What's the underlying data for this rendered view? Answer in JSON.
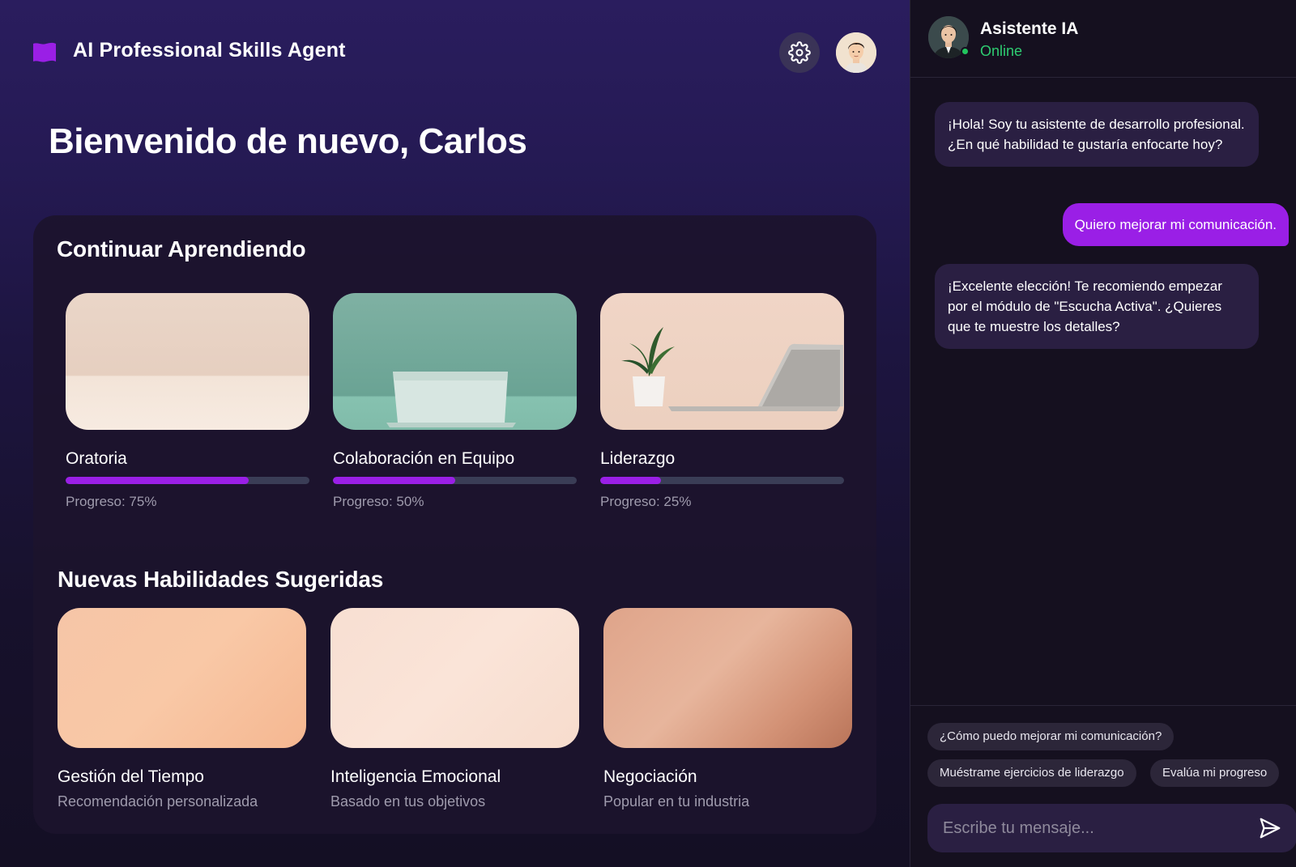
{
  "app": {
    "title": "AI Professional Skills Agent",
    "logo_icon": "flag-icon",
    "brand_color": "#9a1fe6"
  },
  "header": {
    "settings_icon": "gear-icon",
    "avatar_icon": "user-avatar"
  },
  "welcome": {
    "text": "Bienvenido de nuevo, Carlos"
  },
  "continue_learning": {
    "title": "Continuar Aprendiendo",
    "courses": [
      {
        "name": "Oratoria",
        "progress": 0.75,
        "progress_label": "Progreso: 75%"
      },
      {
        "name": "Colaboración en Equipo",
        "progress": 0.5,
        "progress_label": "Progreso: 50%"
      },
      {
        "name": "Liderazgo",
        "progress": 0.25,
        "progress_label": "Progreso: 25%"
      }
    ]
  },
  "suggested": {
    "title": "Nuevas Habilidades Sugeridas",
    "skills": [
      {
        "name": "Gestión del Tiempo",
        "subtitle": "Recomendación personalizada"
      },
      {
        "name": "Inteligencia Emocional",
        "subtitle": "Basado en tus objetivos"
      },
      {
        "name": "Negociación",
        "subtitle": "Popular en tu industria"
      }
    ]
  },
  "chat": {
    "assistant_name": "Asistente IA",
    "status": "Online",
    "status_color": "#2ecc71",
    "messages": [
      {
        "from": "bot",
        "text": "¡Hola! Soy tu asistente de desarrollo profesional. ¿En qué habilidad te gustaría enfocarte hoy?"
      },
      {
        "from": "user",
        "text": "Quiero mejorar mi comunicación."
      },
      {
        "from": "bot",
        "text": "¡Excelente elección! Te recomiendo empezar por el módulo de \"Escucha Activa\". ¿Quieres que te muestre los detalles?"
      }
    ],
    "quick_replies": [
      "¿Cómo puedo mejorar mi comunicación?",
      "Muéstrame ejercicios de liderazgo",
      "Evalúa mi progreso"
    ],
    "input_placeholder": "Escribe tu mensaje...",
    "send_icon": "send-icon"
  }
}
